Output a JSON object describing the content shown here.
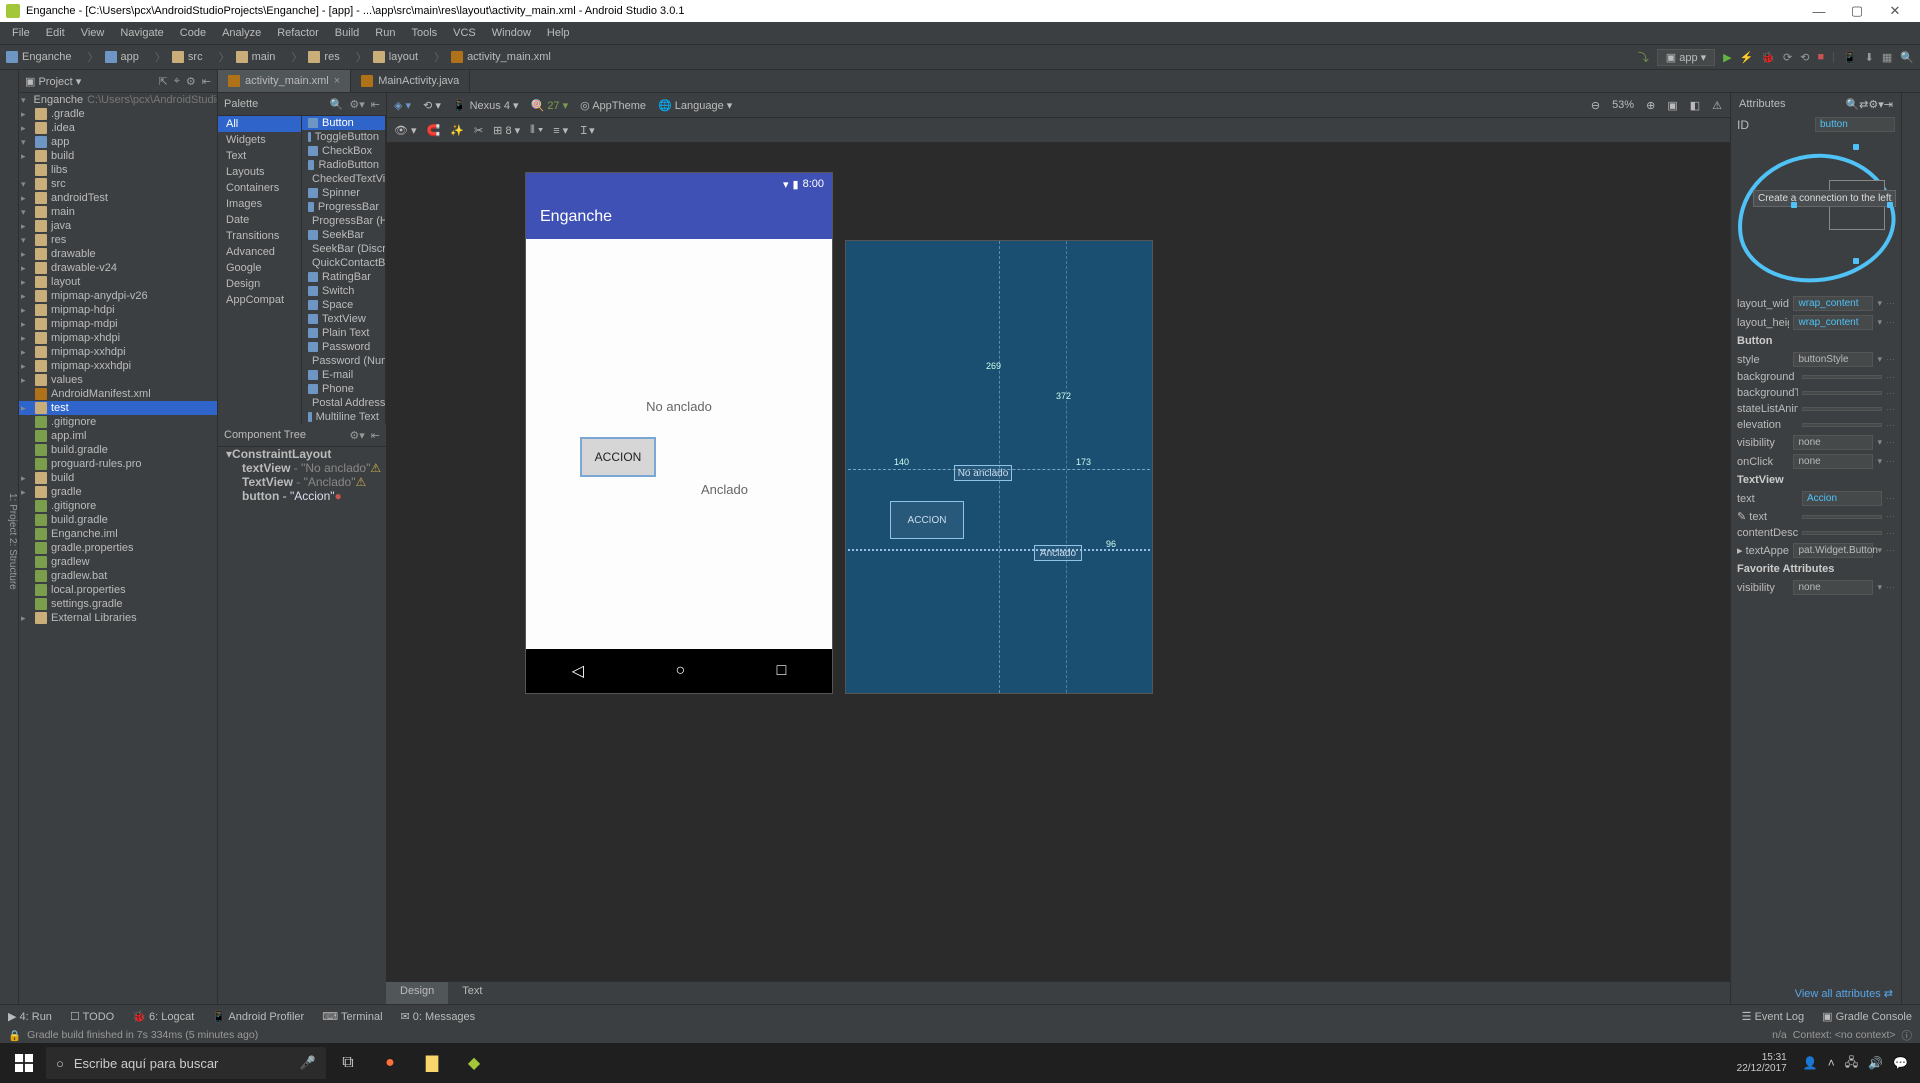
{
  "title": "Enganche - [C:\\Users\\pcx\\AndroidStudioProjects\\Enganche] - [app] - ...\\app\\src\\main\\res\\layout\\activity_main.xml - Android Studio 3.0.1",
  "menu": [
    "File",
    "Edit",
    "View",
    "Navigate",
    "Code",
    "Analyze",
    "Refactor",
    "Build",
    "Run",
    "Tools",
    "VCS",
    "Window",
    "Help"
  ],
  "crumbs": [
    "Enganche",
    "app",
    "src",
    "main",
    "res",
    "layout",
    "activity_main.xml"
  ],
  "run_config": "app",
  "project_header": "Project",
  "tree": [
    {
      "d": 0,
      "a": "▾",
      "t": "Enganche",
      "sub": " C:\\Users\\pcx\\AndroidStudioPr",
      "ic": "mod"
    },
    {
      "d": 1,
      "a": "▸",
      "t": ".gradle",
      "ic": "fold"
    },
    {
      "d": 1,
      "a": "▸",
      "t": ".idea",
      "ic": "fold"
    },
    {
      "d": 1,
      "a": "▾",
      "t": "app",
      "ic": "mod"
    },
    {
      "d": 2,
      "a": "▸",
      "t": "build",
      "ic": "fold"
    },
    {
      "d": 2,
      "a": " ",
      "t": "libs",
      "ic": "fold"
    },
    {
      "d": 2,
      "a": "▾",
      "t": "src",
      "ic": "fold"
    },
    {
      "d": 3,
      "a": "▸",
      "t": "androidTest",
      "ic": "fold"
    },
    {
      "d": 3,
      "a": "▾",
      "t": "main",
      "ic": "fold"
    },
    {
      "d": 4,
      "a": "▸",
      "t": "java",
      "ic": "fold"
    },
    {
      "d": 4,
      "a": "▾",
      "t": "res",
      "ic": "fold"
    },
    {
      "d": 5,
      "a": "▸",
      "t": "drawable",
      "ic": "fold"
    },
    {
      "d": 5,
      "a": "▸",
      "t": "drawable-v24",
      "ic": "fold"
    },
    {
      "d": 5,
      "a": "▸",
      "t": "layout",
      "ic": "fold"
    },
    {
      "d": 5,
      "a": "▸",
      "t": "mipmap-anydpi-v26",
      "ic": "fold"
    },
    {
      "d": 5,
      "a": "▸",
      "t": "mipmap-hdpi",
      "ic": "fold"
    },
    {
      "d": 5,
      "a": "▸",
      "t": "mipmap-mdpi",
      "ic": "fold"
    },
    {
      "d": 5,
      "a": "▸",
      "t": "mipmap-xhdpi",
      "ic": "fold"
    },
    {
      "d": 5,
      "a": "▸",
      "t": "mipmap-xxhdpi",
      "ic": "fold"
    },
    {
      "d": 5,
      "a": "▸",
      "t": "mipmap-xxxhdpi",
      "ic": "fold"
    },
    {
      "d": 5,
      "a": "▸",
      "t": "values",
      "ic": "fold"
    },
    {
      "d": 4,
      "a": " ",
      "t": "AndroidManifest.xml",
      "ic": "xml"
    },
    {
      "d": 3,
      "a": "▸",
      "t": "test",
      "ic": "fold",
      "sel": true
    },
    {
      "d": 2,
      "a": " ",
      "t": ".gitignore",
      "ic": "js"
    },
    {
      "d": 2,
      "a": " ",
      "t": "app.iml",
      "ic": "js"
    },
    {
      "d": 2,
      "a": " ",
      "t": "build.gradle",
      "ic": "js"
    },
    {
      "d": 2,
      "a": " ",
      "t": "proguard-rules.pro",
      "ic": "js"
    },
    {
      "d": 1,
      "a": "▸",
      "t": "build",
      "ic": "fold"
    },
    {
      "d": 1,
      "a": "▸",
      "t": "gradle",
      "ic": "fold"
    },
    {
      "d": 1,
      "a": " ",
      "t": ".gitignore",
      "ic": "js"
    },
    {
      "d": 1,
      "a": " ",
      "t": "build.gradle",
      "ic": "js"
    },
    {
      "d": 1,
      "a": " ",
      "t": "Enganche.iml",
      "ic": "js"
    },
    {
      "d": 1,
      "a": " ",
      "t": "gradle.properties",
      "ic": "js"
    },
    {
      "d": 1,
      "a": " ",
      "t": "gradlew",
      "ic": "js"
    },
    {
      "d": 1,
      "a": " ",
      "t": "gradlew.bat",
      "ic": "js"
    },
    {
      "d": 1,
      "a": " ",
      "t": "local.properties",
      "ic": "js"
    },
    {
      "d": 1,
      "a": " ",
      "t": "settings.gradle",
      "ic": "js"
    },
    {
      "d": 0,
      "a": "▸",
      "t": "External Libraries",
      "ic": "fold"
    }
  ],
  "tabs": [
    {
      "label": "activity_main.xml",
      "active": true,
      "closeable": true
    },
    {
      "label": "MainActivity.java",
      "active": false,
      "closeable": false
    }
  ],
  "palette": {
    "header": "Palette",
    "categories": [
      "All",
      "Widgets",
      "Text",
      "Layouts",
      "Containers",
      "Images",
      "Date",
      "Transitions",
      "Advanced",
      "Google",
      "Design",
      "AppCompat"
    ],
    "widgets": [
      "Button",
      "ToggleButton",
      "CheckBox",
      "RadioButton",
      "CheckedTextVie",
      "Spinner",
      "ProgressBar",
      "ProgressBar (Ho",
      "SeekBar",
      "SeekBar (Discret",
      "QuickContactBa",
      "RatingBar",
      "Switch",
      "Space",
      "TextView",
      "Plain Text",
      "Password",
      "Password (Num",
      "E-mail",
      "Phone",
      "Postal Address",
      "Multiline Text"
    ]
  },
  "design_toolbar": {
    "device": "Nexus 4",
    "api": "27",
    "theme": "AppTheme",
    "lang": "Language",
    "zoom": "53%"
  },
  "device_preview": {
    "time": "8:00",
    "appname": "Enganche",
    "txt1": "No anclado",
    "btn": "ACCION",
    "txt2": "Anclado"
  },
  "blueprint": {
    "m269": "269",
    "m372": "372",
    "m140": "140",
    "m173": "173",
    "m96": "96",
    "noanc": "No anclado",
    "acc": "ACCION",
    "anc": "Anclado"
  },
  "component_tree": {
    "header": "Component Tree",
    "rows": [
      {
        "label": "ConstraintLayout",
        "icon": "layout"
      },
      {
        "label": "textView",
        "suffix": " - \"No anclado\"",
        "warn": true,
        "indent": 1
      },
      {
        "label": "TextView",
        "suffix": " - \"Anclado\"",
        "warn": true,
        "indent": 1
      },
      {
        "label": "button",
        "suffix": " - \"Accion\"",
        "err": true,
        "indent": 1,
        "sel": true
      }
    ]
  },
  "design_tabs": [
    "Design",
    "Text"
  ],
  "attributes": {
    "header": "Attributes",
    "id_label": "ID",
    "id_value": "button",
    "hint": "Create a connection to the left",
    "rows": [
      {
        "l": "layout_width",
        "v": "wrap_content",
        "drop": true,
        "blue": true
      },
      {
        "l": "layout_height",
        "v": "wrap_content",
        "drop": true,
        "blue": true
      }
    ],
    "button_sec": "Button",
    "button_rows": [
      {
        "l": "style",
        "v": "buttonStyle",
        "drop": true
      },
      {
        "l": "background",
        "v": ""
      },
      {
        "l": "backgroundTint",
        "v": ""
      },
      {
        "l": "stateListAnimato",
        "v": ""
      },
      {
        "l": "elevation",
        "v": ""
      },
      {
        "l": "visibility",
        "v": "none",
        "drop": true
      },
      {
        "l": "onClick",
        "v": "none",
        "drop": true
      }
    ],
    "textview_sec": "TextView",
    "textview_rows": [
      {
        "l": "text",
        "v": "Accion",
        "blue": true
      },
      {
        "l": "✎ text",
        "v": ""
      },
      {
        "l": "contentDescript",
        "v": ""
      },
      {
        "l": "▸ textAppearan",
        "v": "pat.Widget.Button",
        "drop": true
      }
    ],
    "fav_sec": "Favorite Attributes",
    "fav_rows": [
      {
        "l": "visibility",
        "v": "none",
        "drop": true
      }
    ],
    "viewall": "View all attributes"
  },
  "bottom": {
    "items": [
      "▶ 4: Run",
      "☐ TODO",
      "🐞 6: Logcat",
      "📱 Android Profiler",
      "⌨ Terminal",
      "✉ 0: Messages"
    ],
    "event": "Event Log",
    "console": "Gradle Console"
  },
  "status": {
    "msg": "Gradle build finished in 7s 334ms (5 minutes ago)",
    "context": "Context: <no context>",
    "na": "n/a"
  },
  "taskbar": {
    "search_placeholder": "Escribe aquí para buscar",
    "time": "15:31",
    "date": "22/12/2017"
  }
}
